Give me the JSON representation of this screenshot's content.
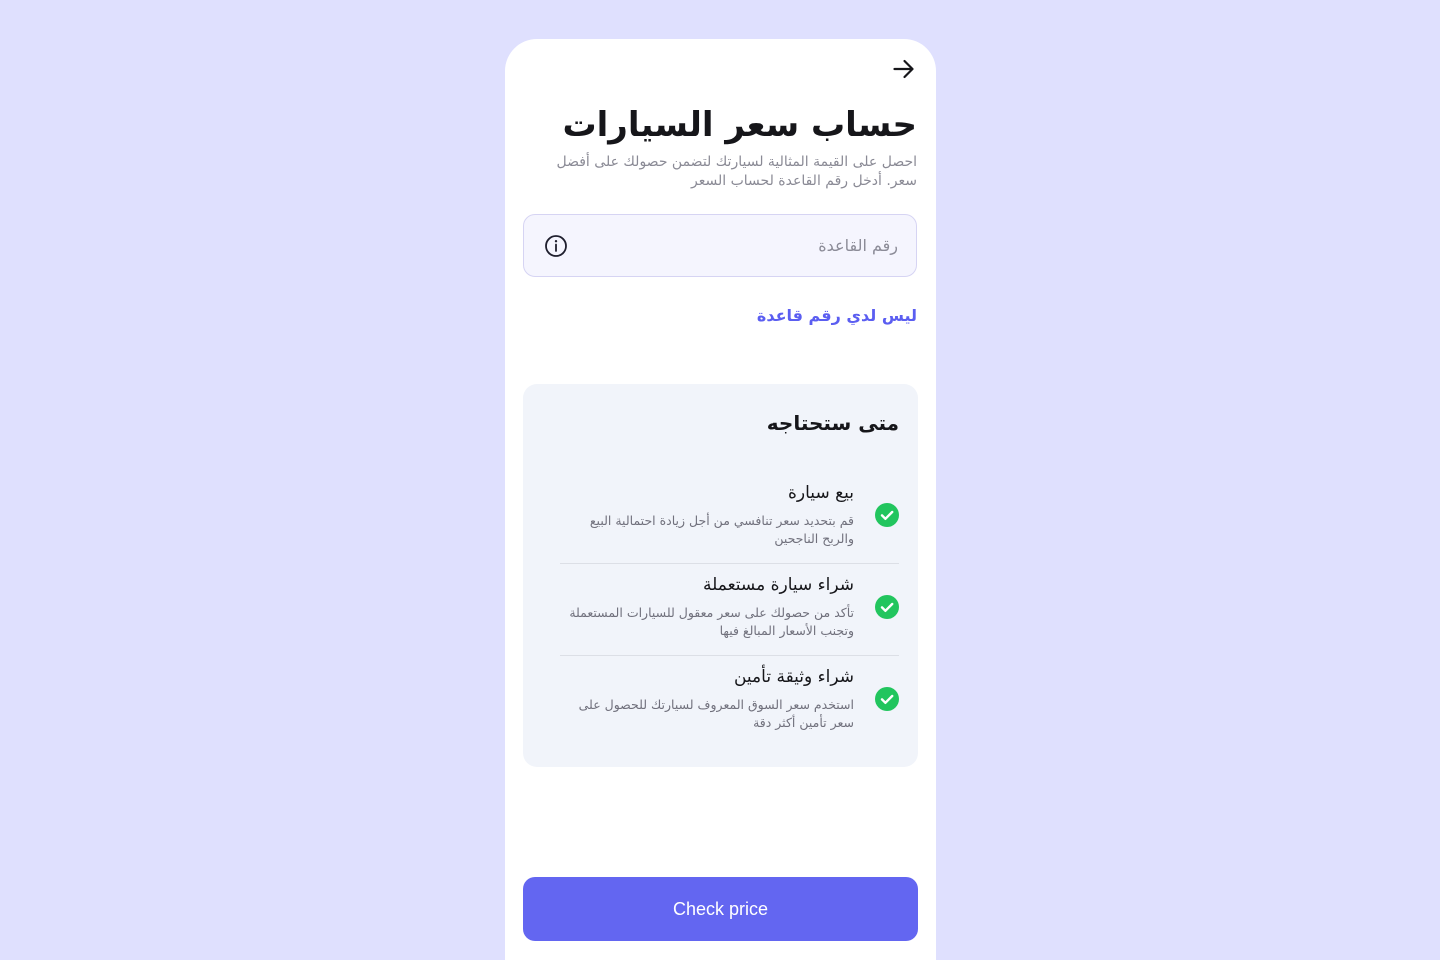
{
  "colors": {
    "background": "#dfe0fe",
    "accent": "#6366f1",
    "link": "#5b5ef1",
    "check": "#22c55e",
    "card": "#f1f4fa"
  },
  "header": {
    "back_icon": "arrow-right-icon",
    "title": "حساب سعر السيارات",
    "subtitle": "احصل على القيمة المثالية لسيارتك لتضمن حصولك على أفضل سعر. أدخل رقم القاعدة لحساب السعر"
  },
  "form": {
    "input_value": "",
    "input_placeholder": "رقم القاعدة",
    "info_icon": "info-icon",
    "no_number_link": "ليس لدي رقم قاعدة"
  },
  "card": {
    "title": "متى ستحتاجه",
    "items": [
      {
        "icon": "check-circle-icon",
        "title": "بيع سيارة",
        "desc": "قم بتحديد سعر تنافسي من أجل زيادة احتمالية البيع والربح الناجحين"
      },
      {
        "icon": "check-circle-icon",
        "title": "شراء سيارة مستعملة",
        "desc": "تأكد من حصولك على سعر معقول للسيارات المستعملة وتجنب الأسعار المبالغ فيها"
      },
      {
        "icon": "check-circle-icon",
        "title": "شراء وثيقة تأمين",
        "desc": "استخدم سعر السوق المعروف لسيارتك للحصول على سعر تأمين أكثر دقة"
      }
    ]
  },
  "footer": {
    "cta_label": "Check price"
  }
}
